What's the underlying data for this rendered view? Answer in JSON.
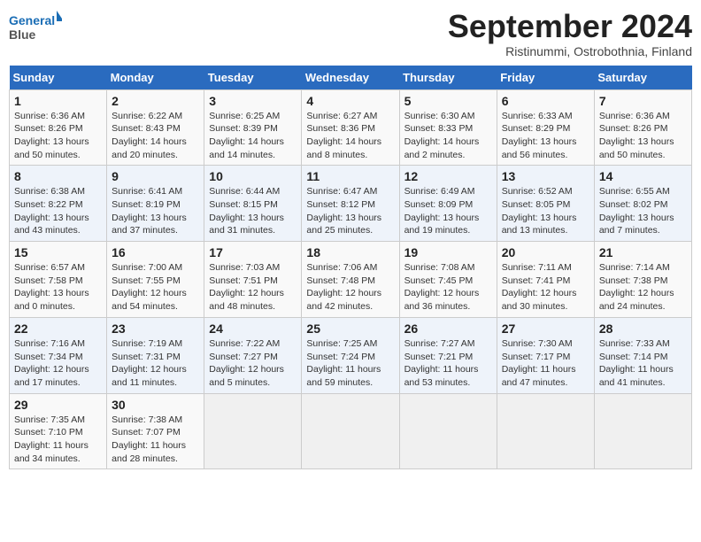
{
  "header": {
    "logo_line1": "General",
    "logo_line2": "Blue",
    "month": "September 2024",
    "location": "Ristinummi, Ostrobothnia, Finland"
  },
  "weekdays": [
    "Sunday",
    "Monday",
    "Tuesday",
    "Wednesday",
    "Thursday",
    "Friday",
    "Saturday"
  ],
  "days": [
    {
      "num": "",
      "detail": ""
    },
    {
      "num": "",
      "detail": ""
    },
    {
      "num": "",
      "detail": ""
    },
    {
      "num": "",
      "detail": ""
    },
    {
      "num": "",
      "detail": ""
    },
    {
      "num": "",
      "detail": ""
    },
    {
      "num": "1",
      "detail": "Sunrise: 6:36 AM\nSunset: 8:26 PM\nDaylight: 13 hours\nand 50 minutes."
    },
    {
      "num": "2",
      "detail": "Sunrise: 6:22 AM\nSunset: 8:43 PM\nDaylight: 14 hours\nand 20 minutes."
    },
    {
      "num": "3",
      "detail": "Sunrise: 6:25 AM\nSunset: 8:39 PM\nDaylight: 14 hours\nand 14 minutes."
    },
    {
      "num": "4",
      "detail": "Sunrise: 6:27 AM\nSunset: 8:36 PM\nDaylight: 14 hours\nand 8 minutes."
    },
    {
      "num": "5",
      "detail": "Sunrise: 6:30 AM\nSunset: 8:33 PM\nDaylight: 14 hours\nand 2 minutes."
    },
    {
      "num": "6",
      "detail": "Sunrise: 6:33 AM\nSunset: 8:29 PM\nDaylight: 13 hours\nand 56 minutes."
    },
    {
      "num": "7",
      "detail": "Sunrise: 6:36 AM\nSunset: 8:26 PM\nDaylight: 13 hours\nand 50 minutes."
    },
    {
      "num": "8",
      "detail": "Sunrise: 6:38 AM\nSunset: 8:22 PM\nDaylight: 13 hours\nand 43 minutes."
    },
    {
      "num": "9",
      "detail": "Sunrise: 6:41 AM\nSunset: 8:19 PM\nDaylight: 13 hours\nand 37 minutes."
    },
    {
      "num": "10",
      "detail": "Sunrise: 6:44 AM\nSunset: 8:15 PM\nDaylight: 13 hours\nand 31 minutes."
    },
    {
      "num": "11",
      "detail": "Sunrise: 6:47 AM\nSunset: 8:12 PM\nDaylight: 13 hours\nand 25 minutes."
    },
    {
      "num": "12",
      "detail": "Sunrise: 6:49 AM\nSunset: 8:09 PM\nDaylight: 13 hours\nand 19 minutes."
    },
    {
      "num": "13",
      "detail": "Sunrise: 6:52 AM\nSunset: 8:05 PM\nDaylight: 13 hours\nand 13 minutes."
    },
    {
      "num": "14",
      "detail": "Sunrise: 6:55 AM\nSunset: 8:02 PM\nDaylight: 13 hours\nand 7 minutes."
    },
    {
      "num": "15",
      "detail": "Sunrise: 6:57 AM\nSunset: 7:58 PM\nDaylight: 13 hours\nand 0 minutes."
    },
    {
      "num": "16",
      "detail": "Sunrise: 7:00 AM\nSunset: 7:55 PM\nDaylight: 12 hours\nand 54 minutes."
    },
    {
      "num": "17",
      "detail": "Sunrise: 7:03 AM\nSunset: 7:51 PM\nDaylight: 12 hours\nand 48 minutes."
    },
    {
      "num": "18",
      "detail": "Sunrise: 7:06 AM\nSunset: 7:48 PM\nDaylight: 12 hours\nand 42 minutes."
    },
    {
      "num": "19",
      "detail": "Sunrise: 7:08 AM\nSunset: 7:45 PM\nDaylight: 12 hours\nand 36 minutes."
    },
    {
      "num": "20",
      "detail": "Sunrise: 7:11 AM\nSunset: 7:41 PM\nDaylight: 12 hours\nand 30 minutes."
    },
    {
      "num": "21",
      "detail": "Sunrise: 7:14 AM\nSunset: 7:38 PM\nDaylight: 12 hours\nand 24 minutes."
    },
    {
      "num": "22",
      "detail": "Sunrise: 7:16 AM\nSunset: 7:34 PM\nDaylight: 12 hours\nand 17 minutes."
    },
    {
      "num": "23",
      "detail": "Sunrise: 7:19 AM\nSunset: 7:31 PM\nDaylight: 12 hours\nand 11 minutes."
    },
    {
      "num": "24",
      "detail": "Sunrise: 7:22 AM\nSunset: 7:27 PM\nDaylight: 12 hours\nand 5 minutes."
    },
    {
      "num": "25",
      "detail": "Sunrise: 7:25 AM\nSunset: 7:24 PM\nDaylight: 11 hours\nand 59 minutes."
    },
    {
      "num": "26",
      "detail": "Sunrise: 7:27 AM\nSunset: 7:21 PM\nDaylight: 11 hours\nand 53 minutes."
    },
    {
      "num": "27",
      "detail": "Sunrise: 7:30 AM\nSunset: 7:17 PM\nDaylight: 11 hours\nand 47 minutes."
    },
    {
      "num": "28",
      "detail": "Sunrise: 7:33 AM\nSunset: 7:14 PM\nDaylight: 11 hours\nand 41 minutes."
    },
    {
      "num": "29",
      "detail": "Sunrise: 7:35 AM\nSunset: 7:10 PM\nDaylight: 11 hours\nand 34 minutes."
    },
    {
      "num": "30",
      "detail": "Sunrise: 7:38 AM\nSunset: 7:07 PM\nDaylight: 11 hours\nand 28 minutes."
    },
    {
      "num": "",
      "detail": ""
    },
    {
      "num": "",
      "detail": ""
    },
    {
      "num": "",
      "detail": ""
    },
    {
      "num": "",
      "detail": ""
    },
    {
      "num": "",
      "detail": ""
    }
  ]
}
